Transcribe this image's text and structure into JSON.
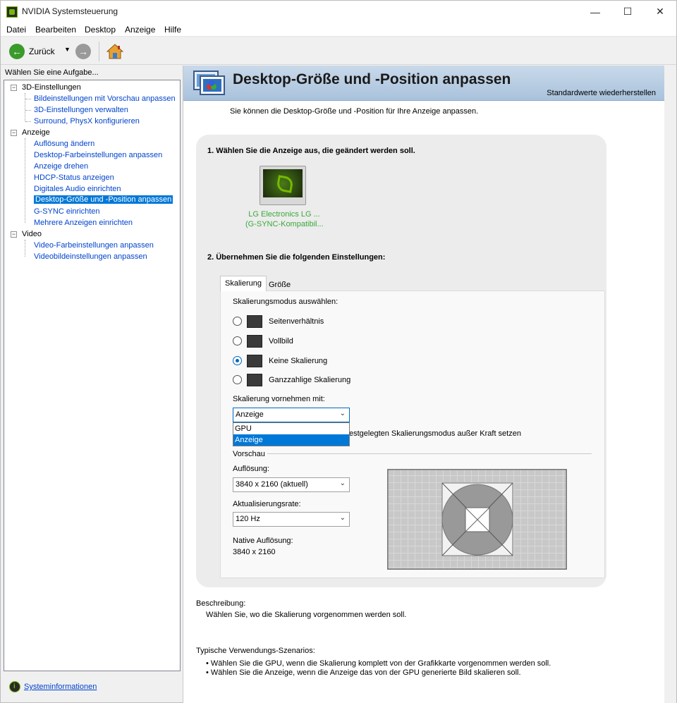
{
  "window": {
    "title": "NVIDIA Systemsteuerung",
    "minimize": "—",
    "maximize": "☐",
    "close": "✕"
  },
  "menu": [
    "Datei",
    "Bearbeiten",
    "Desktop",
    "Anzeige",
    "Hilfe"
  ],
  "toolbar": {
    "back_label": "Zurück"
  },
  "sidebar": {
    "task_label": "Wählen Sie eine Aufgabe...",
    "categories": [
      {
        "label": "3D-Einstellungen",
        "items": [
          "Bildeinstellungen mit Vorschau anpassen",
          "3D-Einstellungen verwalten",
          "Surround, PhysX konfigurieren"
        ]
      },
      {
        "label": "Anzeige",
        "items": [
          "Auflösung ändern",
          "Desktop-Farbeinstellungen anpassen",
          "Anzeige drehen",
          "HDCP-Status anzeigen",
          "Digitales Audio einrichten",
          "Desktop-Größe und -Position anpassen",
          "G-SYNC einrichten",
          "Mehrere Anzeigen einrichten"
        ]
      },
      {
        "label": "Video",
        "items": [
          "Video-Farbeinstellungen anpassen",
          "Videobildeinstellungen anpassen"
        ]
      }
    ],
    "system_info": "Systeminformationen"
  },
  "page": {
    "title": "Desktop-Größe und -Position anpassen",
    "restore": "Standardwerte wiederherstellen",
    "intro": "Sie können die Desktop-Größe und -Position für Ihre Anzeige anpassen.",
    "step1": "1. Wählen Sie die Anzeige aus, die geändert werden soll.",
    "monitor_line1": "LG Electronics LG ...",
    "monitor_line2": "(G-SYNC-Kompatibil...",
    "step2": "2. Übernehmen Sie die folgenden Einstellungen:",
    "tabs": [
      "Skalierung",
      "Größe"
    ],
    "scaling_mode_label": "Skalierungsmodus auswählen:",
    "modes": [
      "Seitenverhältnis",
      "Vollbild",
      "Keine Skalierung",
      "Ganzzahlige Skalierung"
    ],
    "selected_mode": "Keine Skalierung",
    "perform_on_label": "Skalierung vornehmen mit:",
    "perform_on_value": "Anzeige",
    "perform_on_options": [
      "GPU",
      "Anzeige"
    ],
    "override_text": "estgelegten Skalierungsmodus außer Kraft setzen",
    "preview_label": "Vorschau",
    "resolution_label": "Auflösung:",
    "resolution_value": "3840 x 2160 (aktuell)",
    "refresh_label": "Aktualisierungsrate:",
    "refresh_value": "120 Hz",
    "native_label": "Native Auflösung:",
    "native_value": "3840 x 2160"
  },
  "description": {
    "label": "Beschreibung:",
    "text": "Wählen Sie, wo die Skalierung vorgenommen werden soll.",
    "usage_label": "Typische Verwendungs-Szenarios:",
    "usage": [
      "• Wählen Sie die GPU, wenn die Skalierung komplett von der Grafikkarte vorgenommen werden soll.",
      "• Wählen Sie die Anzeige, wenn die Anzeige das von der GPU generierte Bild skalieren soll."
    ]
  },
  "colors": {
    "accent": "#0078d7",
    "nvidia_green": "#76b900",
    "header_band": "#b4c9df"
  }
}
